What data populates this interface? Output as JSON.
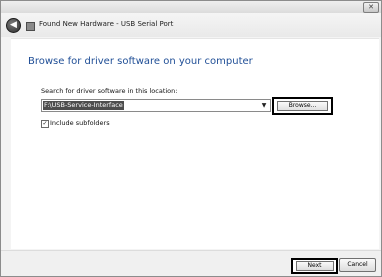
{
  "window": {
    "close_glyph": "✕"
  },
  "navbar": {
    "back_glyph": "◀",
    "title": "Found New Hardware - USB Serial Port",
    "icons": {
      "back": "back-arrow-icon",
      "device": "hardware-device-icon"
    }
  },
  "main": {
    "heading": "Browse for driver software on your computer",
    "search_label": "Search for driver software in this location:",
    "path_value": "F:\\USB-Service-Interface",
    "dropdown_glyph": "▼",
    "browse_label": "Browse...",
    "include_subfolders": {
      "checked": true,
      "check_glyph": "✓",
      "label": "Include subfolders"
    }
  },
  "footer": {
    "next_label": "Next",
    "cancel_label": "Cancel"
  },
  "colors": {
    "heading": "#1f4e96",
    "selection": "#4d4d4d",
    "highlight_border": "#000000"
  }
}
